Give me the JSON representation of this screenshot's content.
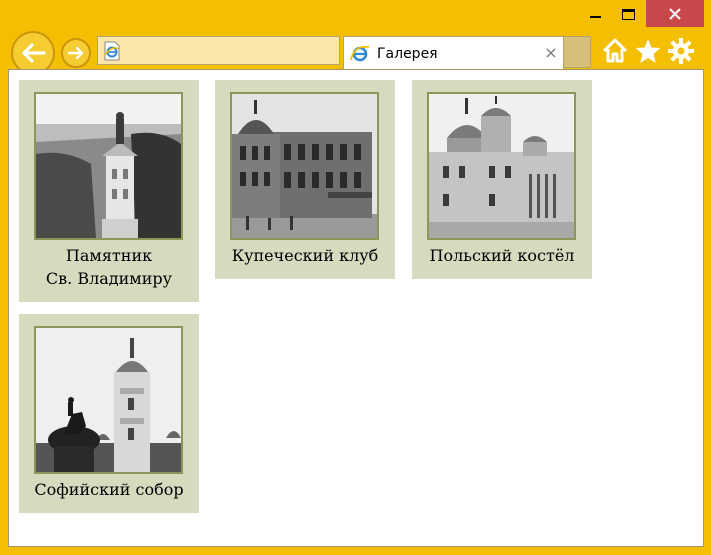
{
  "browser": {
    "tab_title": "Галерея",
    "tab_close": "×",
    "address_value": "",
    "colors": {
      "frame": "#f3bf00",
      "close": "#c7474b",
      "gallery_bg": "#d7dabe",
      "thumb_border": "#8c9656"
    }
  },
  "gallery": {
    "items": [
      {
        "caption_line1": "Памятник",
        "caption_line2": "Св. Владимиру",
        "image": "vladimir-monument-photo"
      },
      {
        "caption_line1": "Купеческий клуб",
        "caption_line2": "",
        "image": "merchants-club-photo"
      },
      {
        "caption_line1": "Польский костёл",
        "caption_line2": "",
        "image": "polish-church-photo"
      },
      {
        "caption_line1": "Софийский собор",
        "caption_line2": "",
        "image": "sophia-cathedral-photo"
      }
    ]
  }
}
